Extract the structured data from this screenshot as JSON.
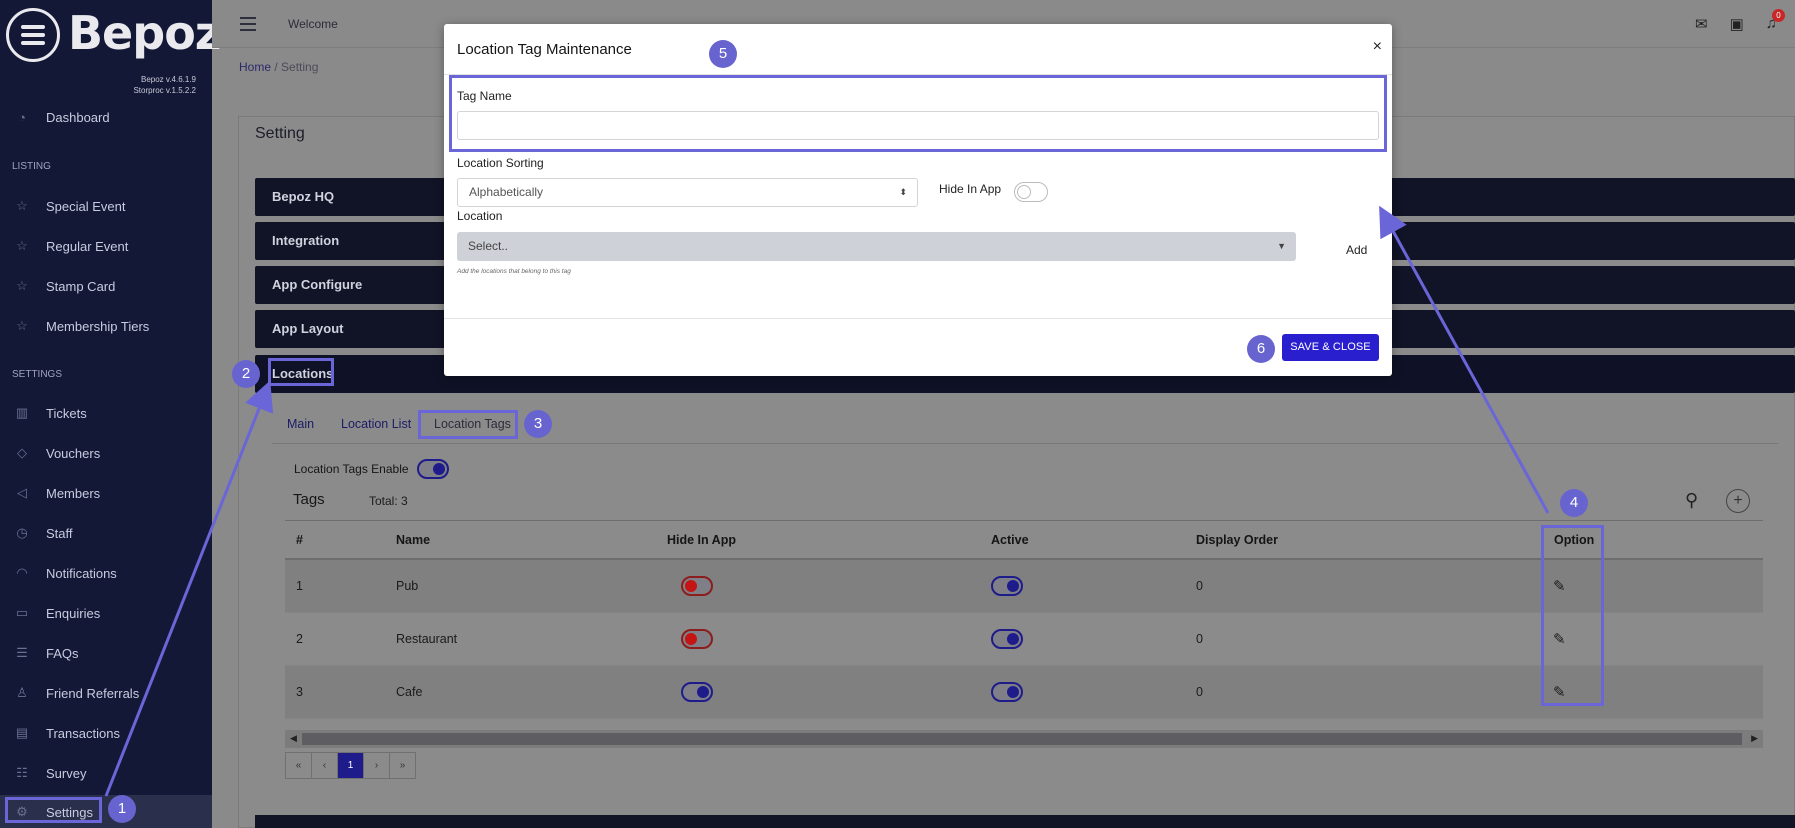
{
  "app": {
    "logo_text": "Bepoz",
    "version_bepoz": "Bepoz v.4.6.1.9",
    "version_storproc": "Storproc v.1.5.2.2"
  },
  "sidebar": {
    "items": [
      {
        "label": "Dashboard",
        "icon": "dashboard-icon"
      },
      {
        "label": "Special Event",
        "icon": "star-icon"
      },
      {
        "label": "Regular Event",
        "icon": "star-icon"
      },
      {
        "label": "Stamp Card",
        "icon": "star-icon"
      },
      {
        "label": "Membership Tiers",
        "icon": "star-icon"
      },
      {
        "label": "Tickets",
        "icon": "ticket-icon"
      },
      {
        "label": "Vouchers",
        "icon": "tag-icon"
      },
      {
        "label": "Members",
        "icon": "send-icon"
      },
      {
        "label": "Staff",
        "icon": "clock-icon"
      },
      {
        "label": "Notifications",
        "icon": "bell-icon"
      },
      {
        "label": "Enquiries",
        "icon": "inbox-icon"
      },
      {
        "label": "FAQs",
        "icon": "list-icon"
      },
      {
        "label": "Friend Referrals",
        "icon": "user-icon"
      },
      {
        "label": "Transactions",
        "icon": "receipt-icon"
      },
      {
        "label": "Survey",
        "icon": "list-icon"
      },
      {
        "label": "Settings",
        "icon": "gear-icon"
      }
    ],
    "section_listing": "LISTING",
    "section_settings": "SETTINGS"
  },
  "topbar": {
    "welcome": "Welcome",
    "notification_count": "0"
  },
  "breadcrumb": {
    "home": "Home",
    "separator": "/",
    "current": "Setting"
  },
  "page": {
    "title": "Setting",
    "sections": [
      "Bepoz HQ",
      "Integration",
      "App Configure",
      "App Layout",
      "Locations"
    ],
    "tabs": [
      "Main",
      "Location List",
      "Location Tags"
    ],
    "tags_enable_label": "Location Tags Enable",
    "tags_title": "Tags",
    "tags_total": "Total: 3"
  },
  "table": {
    "headers": [
      "#",
      "Name",
      "Hide In App",
      "Active",
      "Display Order",
      "Option"
    ],
    "rows": [
      {
        "num": "1",
        "name": "Pub",
        "hide_in_app": false,
        "active": true,
        "display_order": "0"
      },
      {
        "num": "2",
        "name": "Restaurant",
        "hide_in_app": false,
        "active": true,
        "display_order": "0"
      },
      {
        "num": "3",
        "name": "Cafe",
        "hide_in_app": true,
        "active": true,
        "display_order": "0"
      }
    ]
  },
  "pager": {
    "first": "«",
    "prev": "‹",
    "current": "1",
    "next": "›",
    "last": "»"
  },
  "modal": {
    "title": "Location Tag Maintenance",
    "close": "×",
    "tag_name_label": "Tag Name",
    "tag_name_value": "",
    "sorting_label": "Location Sorting",
    "sorting_value": "Alphabetically",
    "hide_in_app_label": "Hide In App",
    "hide_in_app_value": false,
    "location_label": "Location",
    "location_placeholder": "Select..",
    "add_label": "Add",
    "hint": "Add the locations that belong to this tag",
    "save_label": "SAVE & CLOSE"
  },
  "annotations": [
    "1",
    "2",
    "3",
    "4",
    "5",
    "6"
  ],
  "colors": {
    "sidebar_bg": "#131836",
    "primary": "#2a1fcf",
    "annotation": "#6a66d8",
    "toggle_off": "#c51414"
  }
}
